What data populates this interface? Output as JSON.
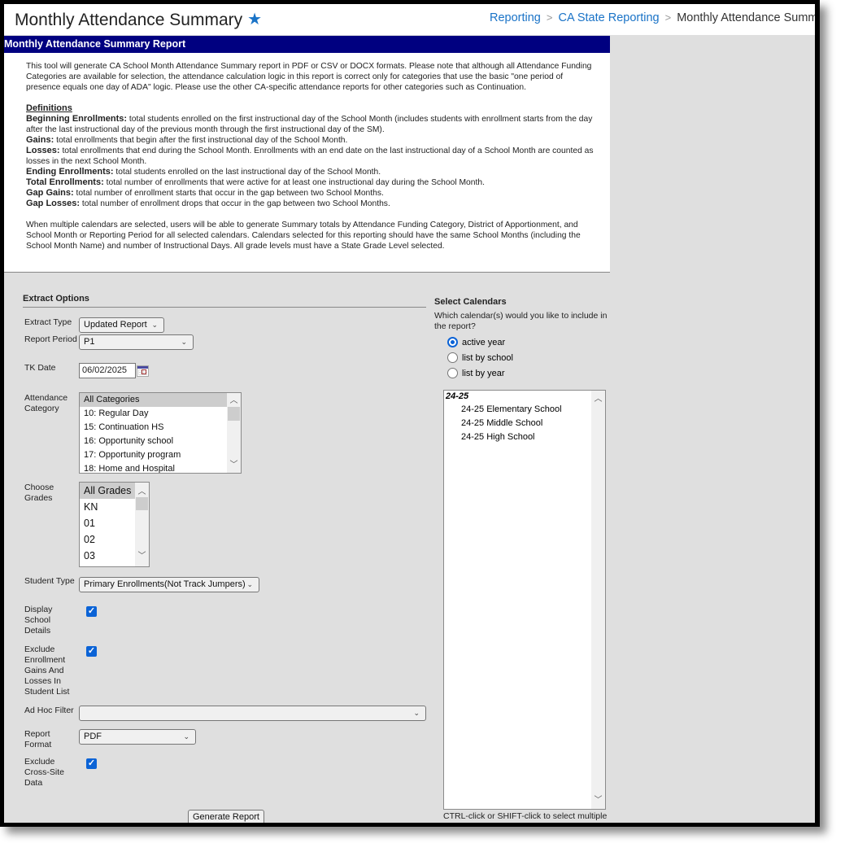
{
  "header": {
    "title": "Monthly Attendance Summary",
    "favorite_icon": "star-icon",
    "breadcrumb": [
      {
        "label": "Reporting",
        "link": true
      },
      {
        "label": "CA State Reporting",
        "link": true
      },
      {
        "label": "Monthly Attendance Summary",
        "link": false
      }
    ],
    "breadcrumb_separator": ">"
  },
  "report": {
    "title": "Monthly Attendance Summary Report",
    "intro": "This tool will generate CA School Month Attendance Summary report in PDF or CSV or DOCX formats. Please note that although all Attendance Funding Categories are available for selection, the attendance calculation logic in this report is correct only for categories that use the basic \"one period of presence equals one day of ADA\" logic. Please use the other CA-specific attendance reports for other categories such as Continuation.",
    "definitions_heading": "Definitions",
    "definitions": [
      {
        "term": "Beginning Enrollments:",
        "text": " total students enrolled on the first instructional day of the School Month (includes students with enrollment starts from the day after the last instructional day of the previous month through the first instructional day of the SM)."
      },
      {
        "term": "Gains:",
        "text": " total enrollments that begin after the first instructional day of the School Month."
      },
      {
        "term": "Losses:",
        "text": " total enrollments that end during the School Month. Enrollments with an end date on the last instructional day of a School Month are counted as losses in the next School Month."
      },
      {
        "term": "Ending Enrollments:",
        "text": " total students enrolled on the last instructional day of the School Month."
      },
      {
        "term": "Total Enrollments:",
        "text": " total number of enrollments that were active for at least one instructional day during the School Month."
      },
      {
        "term": "Gap Gains:",
        "text": " total number of enrollment starts that occur in the gap between two School Months."
      },
      {
        "term": "Gap Losses:",
        "text": " total number of enrollment drops that occur in the gap between two School Months."
      }
    ],
    "multi_calendar_note": "When multiple calendars are selected, users will be able to generate Summary totals by Attendance Funding Category, District of Apportionment, and School Month or Reporting Period for all selected calendars. Calendars selected for this reporting should have the same School Months (including the School Month Name) and number of Instructional Days. All grade levels must have a State Grade Level selected."
  },
  "extract_options": {
    "title": "Extract Options",
    "extract_type": {
      "label": "Extract Type",
      "value": "Updated Report"
    },
    "report_period": {
      "label": "Report Period",
      "value": "P1"
    },
    "tk_date": {
      "label": "TK Date",
      "value": "06/02/2025"
    },
    "attendance_category": {
      "label": "Attendance Category",
      "options": [
        "All Categories",
        "10: Regular Day",
        "15: Continuation HS",
        "16: Opportunity school",
        "17: Opportunity program",
        "18: Home and Hospital"
      ],
      "selected": "All Categories"
    },
    "choose_grades": {
      "label": "Choose Grades",
      "options": [
        "All Grades",
        "KN",
        "01",
        "02",
        "03"
      ],
      "selected": "All Grades"
    },
    "student_type": {
      "label": "Student Type",
      "value": "Primary Enrollments(Not Track Jumpers)"
    },
    "display_school_details": {
      "label": "Display School Details",
      "checked": true
    },
    "exclude_gains_losses": {
      "label": "Exclude Enrollment Gains And Losses In Student List",
      "checked": true
    },
    "ad_hoc_filter": {
      "label": "Ad Hoc Filter",
      "value": ""
    },
    "report_format": {
      "label": "Report Format",
      "value": "PDF"
    },
    "exclude_cross_site": {
      "label": "Exclude Cross-Site Data",
      "checked": true
    },
    "generate_button": "Generate Report"
  },
  "calendars": {
    "title": "Select Calendars",
    "question": "Which calendar(s) would you like to include in the report?",
    "modes": [
      {
        "label": "active year",
        "selected": true
      },
      {
        "label": "list by school",
        "selected": false
      },
      {
        "label": "list by year",
        "selected": false
      }
    ],
    "group": "24-25",
    "items": [
      "24-25 Elementary School",
      "24-25 Middle School",
      "24-25 High School"
    ],
    "hint": "CTRL-click or SHIFT-click to select multiple"
  },
  "colors": {
    "header_bar": "#000080",
    "link": "#1a73c7",
    "checkbox": "#0b63d6",
    "background": "#dfdfdf"
  }
}
